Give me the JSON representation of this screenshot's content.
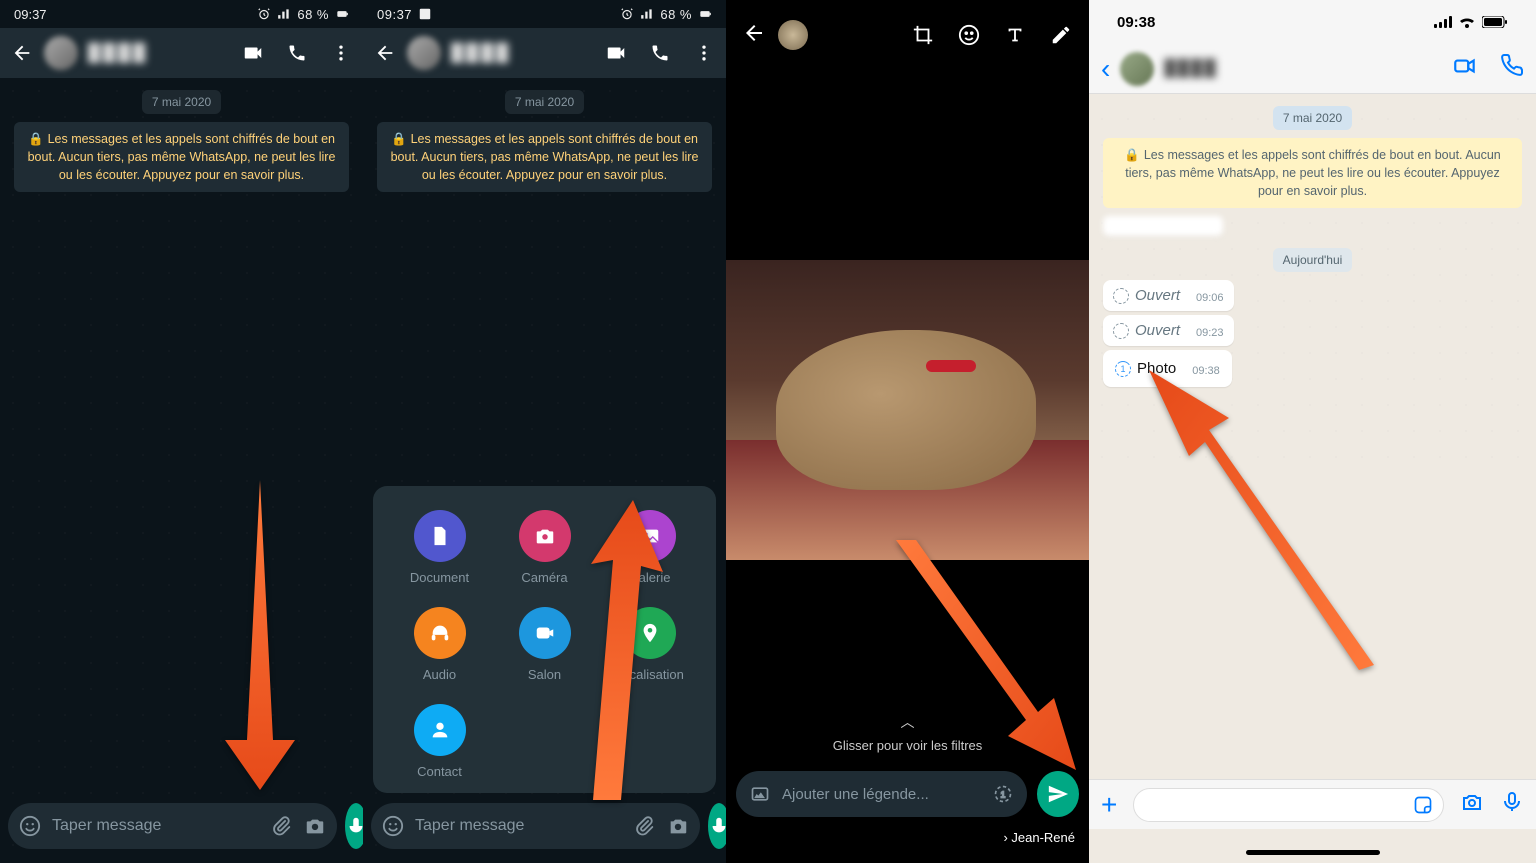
{
  "status_android": {
    "time": "09:37",
    "battery": "68 %"
  },
  "status_ios": {
    "time": "09:38"
  },
  "chat": {
    "date_chip": "7 mai 2020",
    "encryption": "Les messages et les appels sont chiffrés de bout en bout. Aucun tiers, pas même WhatsApp, ne peut les lire ou les écouter. Appuyez pour en savoir plus.",
    "input_placeholder": "Taper message"
  },
  "attach": {
    "items": [
      {
        "label": "Document",
        "color": "#5157ce"
      },
      {
        "label": "Caméra",
        "color": "#d3396d"
      },
      {
        "label": "Galerie",
        "color": "#ac44cf"
      },
      {
        "label": "Audio",
        "color": "#f5841f"
      },
      {
        "label": "Salon",
        "color": "#1d97de"
      },
      {
        "label": "Localisation",
        "color": "#1fa855"
      },
      {
        "label": "Contact",
        "color": "#0eabf4"
      }
    ]
  },
  "editor": {
    "filters_hint": "Glisser pour voir les filtres",
    "caption_placeholder": "Ajouter une légende...",
    "recipient": "Jean-René"
  },
  "ios_chat": {
    "today_chip": "Aujourd'hui",
    "bubbles": [
      {
        "label": "Ouvert",
        "time": "09:06",
        "kind": "opened"
      },
      {
        "label": "Ouvert",
        "time": "09:23",
        "kind": "opened"
      },
      {
        "label": "Photo",
        "time": "09:38",
        "kind": "photo"
      }
    ]
  }
}
